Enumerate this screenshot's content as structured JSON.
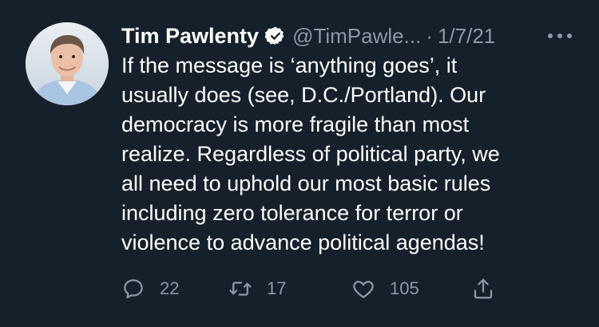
{
  "tweet": {
    "author_name": "Tim Pawlenty",
    "handle": "@TimPawle...",
    "separator": "·",
    "date": "1/7/21",
    "lines": [
      "If the message is ‘anything goes’, it",
      "usually does (see, D.C./Portland). Our",
      "democracy is more fragile than most",
      "realize. Regardless of political party, we",
      "all need to uphold our most basic rules",
      "including zero tolerance for terror or",
      "violence to advance political agendas!"
    ],
    "replies": "22",
    "retweets": "17",
    "likes": "105"
  },
  "icons": {
    "verified": "verified-badge-icon",
    "more": "more-options-icon",
    "reply": "reply-icon",
    "retweet": "retweet-icon",
    "like": "heart-icon",
    "share": "share-icon"
  },
  "colors": {
    "background": "#15202b",
    "text": "#ffffff",
    "muted": "#8b98a5"
  }
}
